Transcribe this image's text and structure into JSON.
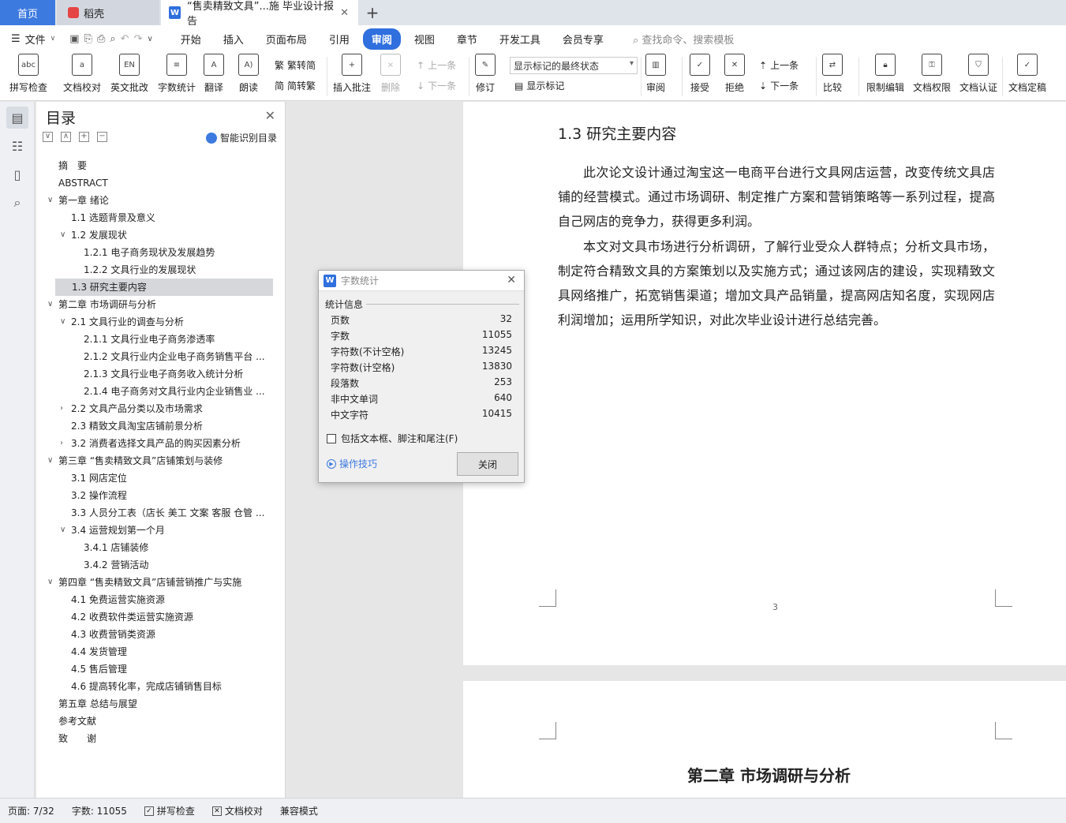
{
  "tabs": {
    "home": "首页",
    "daoke": "稻壳",
    "doc": "“售卖精致文具”...施 毕业设计报告",
    "close": "✕",
    "add": "+"
  },
  "menu": {
    "file": "文件",
    "tabs": [
      "开始",
      "插入",
      "页面布局",
      "引用",
      "审阅",
      "视图",
      "章节",
      "开发工具",
      "会员专享"
    ],
    "active_tab": "审阅",
    "search": "查找命令、搜索模板"
  },
  "ribbon": {
    "spellcheck": "拼写检查",
    "proofread": "文档校对",
    "english_review": "英文批改",
    "word_count": "字数统计",
    "translate": "翻译",
    "read_aloud": "朗读",
    "trad_to_simp": "繁转简",
    "simp_to_trad": "简转繁",
    "insert_comment": "插入批注",
    "delete": "删除",
    "prev": "上一条",
    "next": "下一条",
    "revise": "修订",
    "markup_state": "显示标记的最终状态",
    "show_markup": "显示标记",
    "review": "审阅",
    "accept": "接受",
    "reject": "拒绝",
    "prev2": "上一条",
    "next2": "下一条",
    "compare": "比较",
    "restrict_edit": "限制编辑",
    "doc_rights": "文档权限",
    "doc_auth": "文档认证",
    "doc_finalize": "文档定稿"
  },
  "toc": {
    "title": "目录",
    "smart": "智能识别目录",
    "items": [
      {
        "text": "摘　要",
        "level": 1,
        "arrow": ""
      },
      {
        "text": "ABSTRACT",
        "level": 1,
        "arrow": ""
      },
      {
        "text": "第一章  绪论",
        "level": 1,
        "arrow": "v"
      },
      {
        "text": "1.1 选题背景及意义",
        "level": 2,
        "arrow": ""
      },
      {
        "text": "1.2 发展现状",
        "level": 2,
        "arrow": "v"
      },
      {
        "text": "1.2.1 电子商务现状及发展趋势",
        "level": 3,
        "arrow": ""
      },
      {
        "text": "1.2.2 文具行业的发展现状",
        "level": 3,
        "arrow": ""
      },
      {
        "text": "1.3 研究主要内容",
        "level": 2,
        "arrow": "",
        "selected": true
      },
      {
        "text": "第二章  市场调研与分析",
        "level": 1,
        "arrow": "v"
      },
      {
        "text": "2.1 文具行业的调查与分析",
        "level": 2,
        "arrow": "v"
      },
      {
        "text": "2.1.1 文具行业电子商务渗透率",
        "level": 3,
        "arrow": ""
      },
      {
        "text": "2.1.2 文具行业内企业电子商务销售平台 ...",
        "level": 3,
        "arrow": ""
      },
      {
        "text": "2.1.3 文具行业电子商务收入统计分析",
        "level": 3,
        "arrow": ""
      },
      {
        "text": "2.1.4 电子商务对文具行业内企业销售业 ...",
        "level": 3,
        "arrow": ""
      },
      {
        "text": "2.2 文具产品分类以及市场需求",
        "level": 2,
        "arrow": ">"
      },
      {
        "text": "2.3 精致文具淘宝店铺前景分析",
        "level": 2,
        "arrow": ""
      },
      {
        "text": "3.2 消费者选择文具产品的购买因素分析",
        "level": 2,
        "arrow": ">"
      },
      {
        "text": "第三章  “售卖精致文具”店铺策划与装修",
        "level": 1,
        "arrow": "v"
      },
      {
        "text": "3.1 网店定位",
        "level": 2,
        "arrow": ""
      },
      {
        "text": "3.2 操作流程",
        "level": 2,
        "arrow": ""
      },
      {
        "text": "3.3 人员分工表（店长  美工  文案  客服  仓管 ...",
        "level": 2,
        "arrow": ""
      },
      {
        "text": "3.4 运营规划第一个月",
        "level": 2,
        "arrow": "v"
      },
      {
        "text": "3.4.1 店铺装修",
        "level": 3,
        "arrow": ""
      },
      {
        "text": "3.4.2 营销活动",
        "level": 3,
        "arrow": ""
      },
      {
        "text": "第四章  “售卖精致文具”店铺营销推广与实施",
        "level": 1,
        "arrow": "v"
      },
      {
        "text": "4.1 免费运营实施资源",
        "level": 2,
        "arrow": ""
      },
      {
        "text": "4.2 收费软件类运营实施资源",
        "level": 2,
        "arrow": ""
      },
      {
        "text": "4.3 收费营销类资源",
        "level": 2,
        "arrow": ""
      },
      {
        "text": "4.4 发货管理",
        "level": 2,
        "arrow": ""
      },
      {
        "text": "4.5 售后管理",
        "level": 2,
        "arrow": ""
      },
      {
        "text": "4.6 提高转化率，完成店铺销售目标",
        "level": 2,
        "arrow": ""
      },
      {
        "text": "第五章  总结与展望",
        "level": 1,
        "arrow": ""
      },
      {
        "text": "参考文献",
        "level": 1,
        "arrow": ""
      },
      {
        "text": "致　　谢",
        "level": 1,
        "arrow": ""
      }
    ]
  },
  "document": {
    "heading": "1.3 研究主要内容",
    "para1": "此次论文设计通过淘宝这一电商平台进行文具网店运营，改变传统文具店铺的经营模式。通过市场调研、制定推广方案和营销策略等一系列过程，提高自己网店的竞争力，获得更多利润。",
    "para2": "本文对文具市场进行分析调研，了解行业受众人群特点；分析文具市场，制定符合精致文具的方案策划以及实施方式；通过该网店的建设，实现精致文具网络推广，拓宽销售渠道；增加文具产品销量，提高网店知名度，实现网店利润增加；运用所学知识，对此次毕业设计进行总结完善。",
    "page_number": "3",
    "next_chapter": "第二章  市场调研与分析"
  },
  "dialog": {
    "title": "字数统计",
    "section": "统计信息",
    "rows": [
      {
        "label": "页数",
        "value": "32"
      },
      {
        "label": "字数",
        "value": "11055"
      },
      {
        "label": "字符数(不计空格)",
        "value": "13245"
      },
      {
        "label": "字符数(计空格)",
        "value": "13830"
      },
      {
        "label": "段落数",
        "value": "253"
      },
      {
        "label": "非中文单词",
        "value": "640"
      },
      {
        "label": "中文字符",
        "value": "10415"
      }
    ],
    "checkbox": "包括文本框、脚注和尾注(F)",
    "tips": "操作技巧",
    "close": "关闭"
  },
  "status": {
    "page": "页面: 7/32",
    "words": "字数: 11055",
    "spell": "拼写检查",
    "proof": "文档校对",
    "compat": "兼容模式"
  }
}
